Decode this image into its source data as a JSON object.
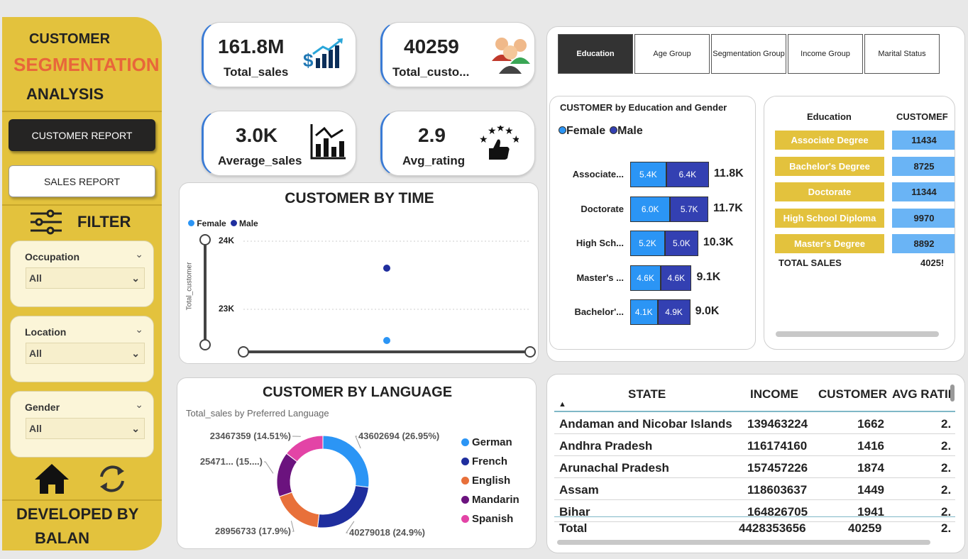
{
  "sidebar": {
    "title_line1": "CUSTOMER",
    "title_line2": "SEGMENTATION",
    "title_line3": "ANALYSIS",
    "nav": [
      {
        "label": "CUSTOMER REPORT"
      },
      {
        "label": "SALES REPORT"
      }
    ],
    "filter_label": "FILTER",
    "filters": [
      {
        "label": "Occupation",
        "value": "All"
      },
      {
        "label": "Location",
        "value": "All"
      },
      {
        "label": "Gender",
        "value": "All"
      }
    ],
    "developed_line1": "DEVELOPED BY",
    "developed_line2": "BALAN"
  },
  "kpis": [
    {
      "value": "161.8M",
      "label": "Total_sales",
      "icon": "sales-growth-icon"
    },
    {
      "value": "40259",
      "label": "Total_custo...",
      "icon": "customers-icon"
    },
    {
      "value": "3.0K",
      "label": "Average_sales",
      "icon": "bar-chart-icon"
    },
    {
      "value": "2.9",
      "label": "Avg_rating",
      "icon": "rating-thumb-icon"
    }
  ],
  "tabs": [
    "Education",
    "Age Group",
    "Segmentation Group",
    "Income Group",
    "Marital Status"
  ],
  "time_chart": {
    "title": "CUSTOMER BY TIME",
    "ylabel": "Total_customer",
    "yticks": [
      "24K",
      "23K"
    ],
    "legend": [
      "Female",
      "Male"
    ],
    "colors": {
      "Female": "#2b95f5",
      "Male": "#1f2e9e"
    }
  },
  "edu_chart": {
    "title": "CUSTOMER by Education and Gender",
    "legend": [
      "Female",
      "Male"
    ],
    "rows": [
      {
        "label": "Associate...",
        "female": "5.4K",
        "male": "6.4K",
        "total": "11.8K",
        "f": 5.4,
        "m": 6.4
      },
      {
        "label": "Doctorate",
        "female": "6.0K",
        "male": "5.7K",
        "total": "11.7K",
        "f": 6.0,
        "m": 5.7
      },
      {
        "label": "High Sch...",
        "female": "5.2K",
        "male": "5.0K",
        "total": "10.3K",
        "f": 5.2,
        "m": 5.0
      },
      {
        "label": "Master's ...",
        "female": "4.6K",
        "male": "4.6K",
        "total": "9.1K",
        "f": 4.6,
        "m": 4.6
      },
      {
        "label": "Bachelor'...",
        "female": "4.1K",
        "male": "4.9K",
        "total": "9.0K",
        "f": 4.1,
        "m": 4.9
      }
    ]
  },
  "edu_table": {
    "headers": [
      "Education",
      "CUSTOMEF"
    ],
    "rows": [
      {
        "education": "Associate Degree",
        "customer": "11434"
      },
      {
        "education": "Bachelor's Degree",
        "customer": "8725"
      },
      {
        "education": "Doctorate",
        "customer": "11344"
      },
      {
        "education": "High School Diploma",
        "customer": "9970"
      },
      {
        "education": "Master's Degree",
        "customer": "8892"
      }
    ],
    "total_label": "TOTAL SALES",
    "total_value": "4025!"
  },
  "lang_chart": {
    "title": "CUSTOMER BY LANGUAGE",
    "subtitle": "Total_sales by Preferred Language",
    "slices": [
      {
        "name": "German",
        "value": 43602694,
        "label": "43602694 (26.95%)",
        "color": "#2b95f5"
      },
      {
        "name": "French",
        "value": 40279018,
        "label": "40279018 (24.9%)",
        "color": "#1f2e9e"
      },
      {
        "name": "English",
        "value": 28956733,
        "label": "28956733 (17.9%)",
        "color": "#e8703a"
      },
      {
        "name": "Mandarin",
        "value": 25471000,
        "label": "25471... (15....)",
        "color": "#6b137e"
      },
      {
        "name": "Spanish",
        "value": 23467359,
        "label": "23467359 (14.51%)",
        "color": "#e344a6"
      }
    ]
  },
  "state_table": {
    "headers": [
      "STATE",
      "INCOME",
      "CUSTOMER",
      "AVG RATII"
    ],
    "rows": [
      {
        "state": "Andaman and Nicobar Islands",
        "income": "139463224",
        "customer": "1662",
        "rating": "2."
      },
      {
        "state": "Andhra Pradesh",
        "income": "116174160",
        "customer": "1416",
        "rating": "2."
      },
      {
        "state": "Arunachal Pradesh",
        "income": "157457226",
        "customer": "1874",
        "rating": "2."
      },
      {
        "state": "Assam",
        "income": "118603637",
        "customer": "1449",
        "rating": "2."
      },
      {
        "state": "Bihar",
        "income": "164826705",
        "customer": "1941",
        "rating": "2."
      }
    ],
    "total": {
      "state": "Total",
      "income": "4428353656",
      "customer": "40259",
      "rating": "2."
    }
  }
}
